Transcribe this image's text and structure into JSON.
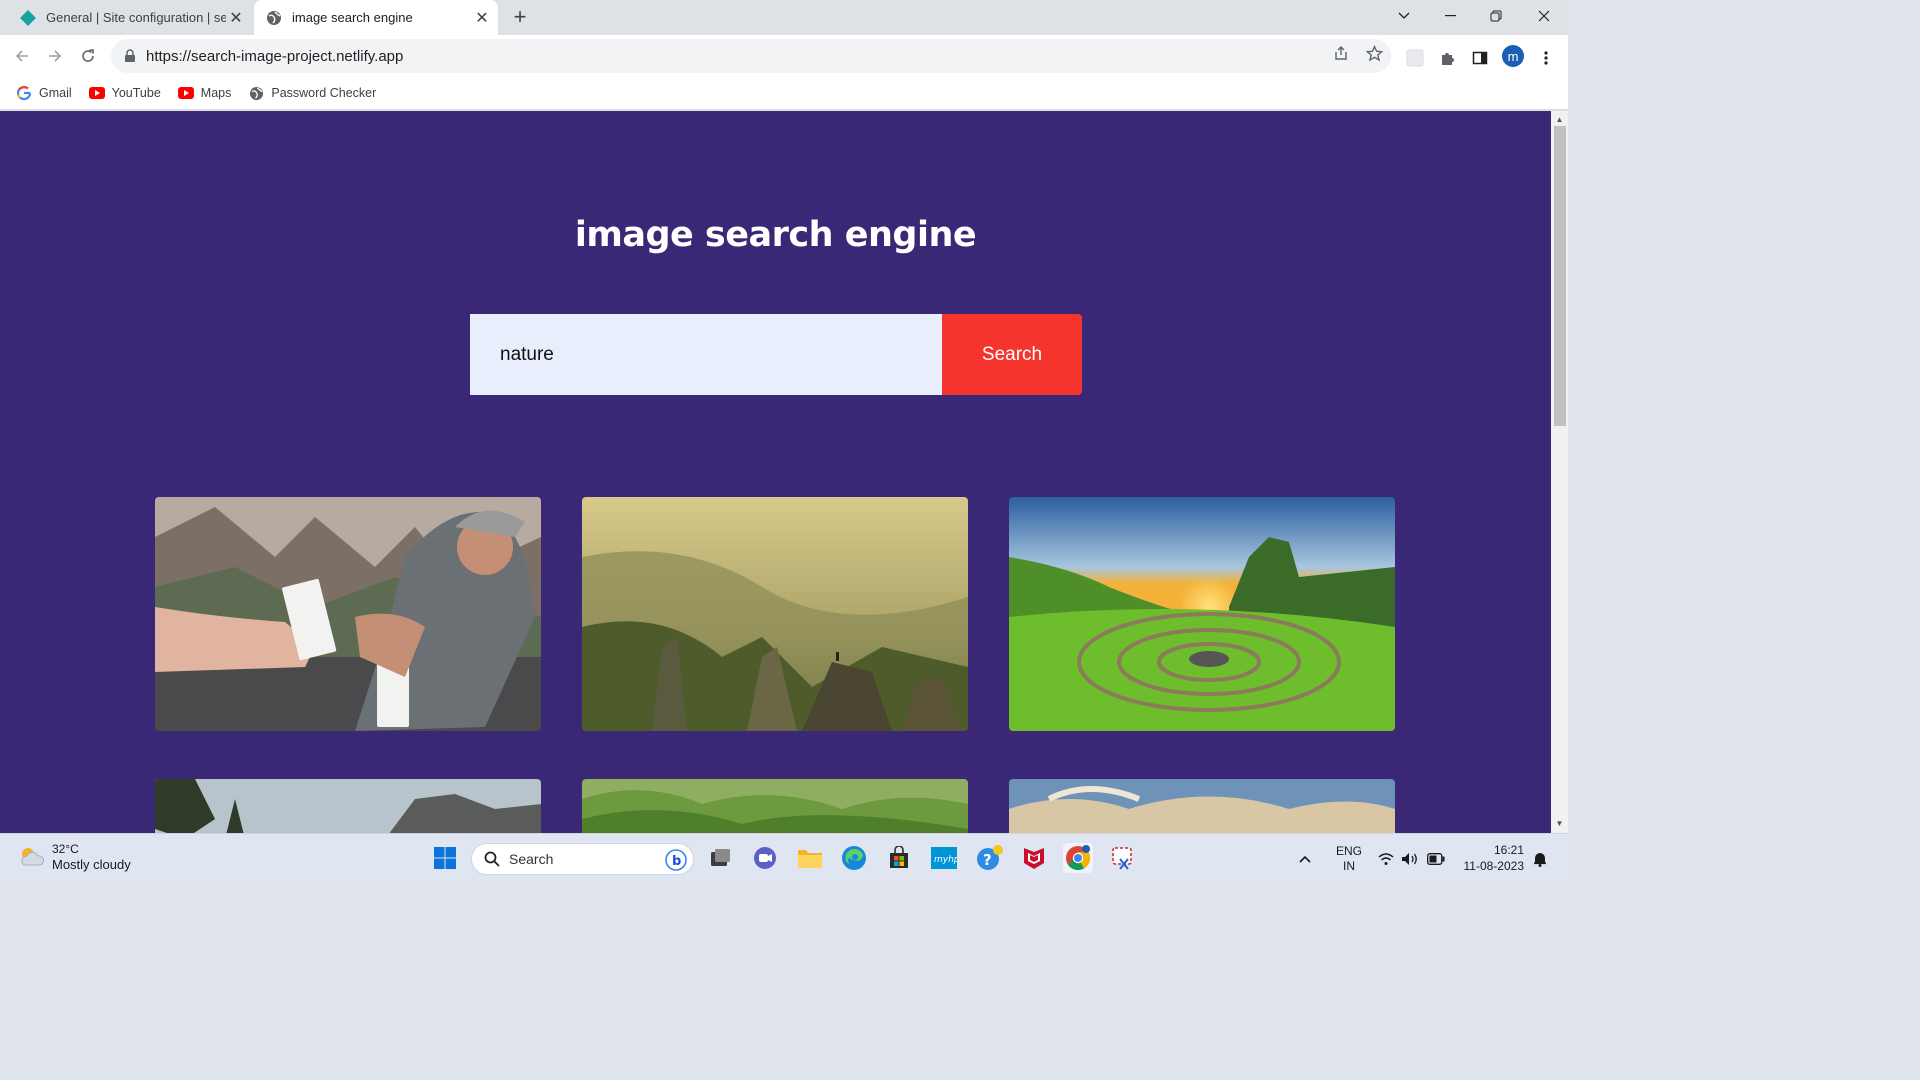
{
  "browser": {
    "tabs": [
      {
        "title": "General | Site configuration | search",
        "active": false,
        "favicon": "netlify-diamond-icon"
      },
      {
        "title": "image search engine",
        "active": true,
        "favicon": "globe-icon"
      }
    ],
    "url": "https://search-image-project.netlify.app",
    "profile_initial": "m",
    "bookmarks": [
      {
        "label": "Gmail",
        "icon": "google-icon"
      },
      {
        "label": "YouTube",
        "icon": "youtube-icon"
      },
      {
        "label": "Maps",
        "icon": "youtube-icon"
      },
      {
        "label": "Password Checker",
        "icon": "globe-icon"
      }
    ]
  },
  "page": {
    "title": "image search engine",
    "search": {
      "value": "nature",
      "button_label": "Search"
    },
    "colors": {
      "background": "#3a2876",
      "button": "#f5342d",
      "input": "#e8eefc"
    },
    "results": [
      {
        "description": "people-holding-water-cartons-mountains"
      },
      {
        "description": "misty-mountain-valley-hiker"
      },
      {
        "description": "green-field-spiral-sunset"
      },
      {
        "description": "tree-cliff-landscape"
      },
      {
        "description": "green-rolling-hills"
      },
      {
        "description": "sky-clouds-landscape"
      }
    ]
  },
  "taskbar": {
    "weather": {
      "temp": "32°C",
      "condition": "Mostly cloudy"
    },
    "search_label": "Search",
    "language": {
      "line1": "ENG",
      "line2": "IN"
    },
    "time": "16:21",
    "date": "11-08-2023"
  }
}
